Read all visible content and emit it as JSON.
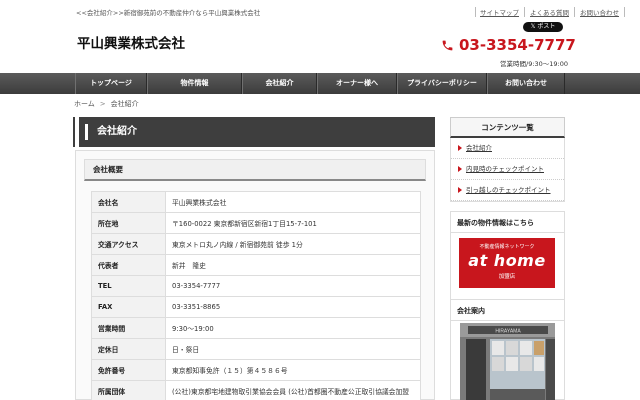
{
  "header": {
    "tagline": "<<会社紹介>>新宿御苑前の不動産仲介なら平山興業株式会社",
    "top_links": [
      "サイトマップ",
      "よくある質問",
      "お問い合わせ"
    ],
    "post_button": "ポスト",
    "logo": "平山興業株式会社",
    "phone": "03-3354-7777",
    "hours": "営業時間/9:30〜19:00"
  },
  "nav": {
    "items": [
      "トップページ",
      "物件情報",
      "会社紹介",
      "オーナー様へ",
      "プライバシーポリシー",
      "お問い合わせ"
    ]
  },
  "breadcrumb": {
    "home": "ホーム",
    "separator": ">",
    "current": "会社紹介"
  },
  "main": {
    "title": "会社紹介",
    "section_title": "会社概要",
    "rows": [
      {
        "k": "会社名",
        "v": "平山興業株式会社"
      },
      {
        "k": "所在地",
        "v": "〒160-0022 東京都新宿区新宿1丁目15-7-101"
      },
      {
        "k": "交通アクセス",
        "v": "東京メトロ丸ノ内線 / 新宿御苑前 徒歩 1分"
      },
      {
        "k": "代表者",
        "v": "新井　隆史"
      },
      {
        "k": "TEL",
        "v": "03-3354-7777"
      },
      {
        "k": "FAX",
        "v": "03-3351-8865"
      },
      {
        "k": "営業時間",
        "v": "9:30〜19:00"
      },
      {
        "k": "定休日",
        "v": "日・祭日"
      },
      {
        "k": "免許番号",
        "v": "東京都知事免許（１５）第４５８６号"
      },
      {
        "k": "所属団体",
        "v": "(公社)東京都宅地建物取引業協会会員 (公社)首都圏不動産公正取引協議会加盟"
      }
    ]
  },
  "sidebar": {
    "contents_title": "コンテンツ一覧",
    "contents_items": [
      "会社紹介",
      "内見時のチェックポイント",
      "引っ越しのチェックポイント"
    ],
    "latest_title": "最新の物件情報はこちら",
    "athome_small": "不動産情報ネットワーク",
    "athome_brand": "at home",
    "athome_store": "加盟店",
    "shop_title": "会社案内",
    "shop_sign": "HIRAYAMA"
  },
  "colors": {
    "accent": "#c8161d",
    "nav_bg": "#4a4a4a",
    "title_bg": "#3e3e3e"
  }
}
